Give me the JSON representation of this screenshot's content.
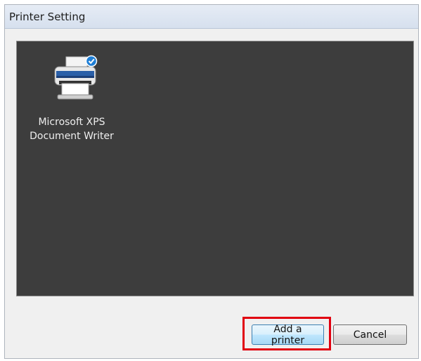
{
  "window": {
    "title": "Printer Setting"
  },
  "printers": [
    {
      "name_line1": "Microsoft XPS",
      "name_line2": "Document Writer",
      "icon": "printer-icon",
      "status_icon": "checkmark-badge-icon",
      "is_default": true
    }
  ],
  "buttons": {
    "add_printer": "Add a printer",
    "cancel": "Cancel"
  },
  "colors": {
    "pane_background": "#3d3d3d",
    "highlight": "#e10010",
    "badge": "#1f7fd6"
  }
}
